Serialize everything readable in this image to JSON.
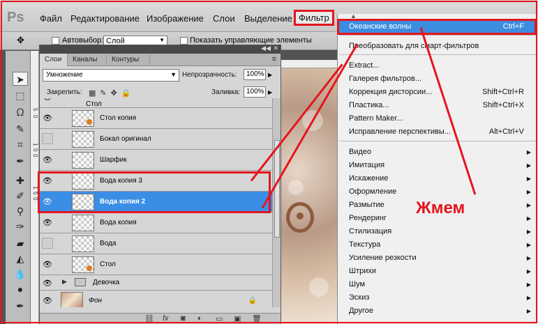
{
  "menubar": {
    "logo": "Ps",
    "items": [
      "Файл",
      "Редактирование",
      "Изображение",
      "Слои",
      "Выделение",
      "Фильтр"
    ]
  },
  "optbar": {
    "autoselect_label": "Автовыбор:",
    "autoselect_value": "Слой",
    "show_controls_label": "Показать управляющие элементы"
  },
  "ruler": {
    "marks": [
      "5",
      "0",
      "1",
      "0",
      "0",
      "1",
      "5",
      "0"
    ]
  },
  "layers_panel": {
    "tabs": [
      "Слои",
      "Каналы",
      "Контуры"
    ],
    "blend_mode": "Умножение",
    "opacity_label": "Непрозрачность:",
    "opacity_value": "100%",
    "lock_label": "Закрепить:",
    "fill_label": "Заливка:",
    "fill_value": "100%",
    "partial_top": "Стол",
    "layers": [
      {
        "name": "Стол копия",
        "visible": true
      },
      {
        "name": "Бокал оригинал",
        "visible": false
      },
      {
        "name": "Шарфик",
        "visible": true
      },
      {
        "name": "Вода копия 3",
        "visible": true
      },
      {
        "name": "Вода копия 2",
        "visible": true,
        "selected": true
      },
      {
        "name": "Вода копия",
        "visible": true
      },
      {
        "name": "Вода",
        "visible": false
      },
      {
        "name": "Стол",
        "visible": true
      },
      {
        "name": "Девочка",
        "visible": true,
        "group": true
      },
      {
        "name": "Фон",
        "visible": true,
        "background": true
      }
    ]
  },
  "filter_menu": {
    "items": [
      {
        "label": "Океанские волны",
        "shortcut": "Ctrl+F",
        "highlighted": true
      },
      {
        "label": "Преобразовать для смарт-фильтров"
      },
      {
        "label": "Extract..."
      },
      {
        "label": "Галерея фильтров..."
      },
      {
        "label": "Коррекция дисторсии...",
        "shortcut": "Shift+Ctrl+R"
      },
      {
        "label": "Пластика...",
        "shortcut": "Shift+Ctrl+X"
      },
      {
        "label": "Pattern Maker..."
      },
      {
        "label": "Исправление перспективы...",
        "shortcut": "Alt+Ctrl+V"
      },
      {
        "label": "Видео",
        "submenu": true
      },
      {
        "label": "Имитация",
        "submenu": true
      },
      {
        "label": "Искажение",
        "submenu": true
      },
      {
        "label": "Оформление",
        "submenu": true
      },
      {
        "label": "Размытие",
        "submenu": true
      },
      {
        "label": "Рендеринг",
        "submenu": true
      },
      {
        "label": "Стилизация",
        "submenu": true
      },
      {
        "label": "Текстура",
        "submenu": true
      },
      {
        "label": "Усиление резкости",
        "submenu": true
      },
      {
        "label": "Штрихи",
        "submenu": true
      },
      {
        "label": "Шум",
        "submenu": true
      },
      {
        "label": "Эскиз",
        "submenu": true
      },
      {
        "label": "Другое",
        "submenu": true
      }
    ]
  },
  "annotation": {
    "text": "Жмем",
    "color": "#e3161d"
  },
  "colors": {
    "highlight": "#3a8ee6",
    "menu_highlight": "#3c8de0"
  }
}
